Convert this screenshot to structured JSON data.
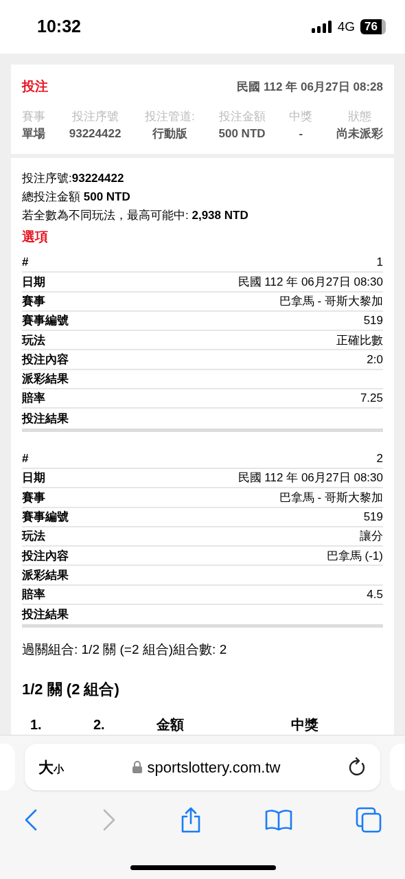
{
  "status_bar": {
    "time": "10:32",
    "network": "4G",
    "battery": "76"
  },
  "summary": {
    "title": "投注",
    "datetime": "民國 112 年 06月27日 08:28",
    "columns": [
      {
        "heading": "賽事",
        "value": "單場"
      },
      {
        "heading": "投注序號",
        "value": "93224422"
      },
      {
        "heading": "投注管道:",
        "value": "行動版"
      },
      {
        "heading": "投注金額",
        "value": "500 NTD"
      },
      {
        "heading": "中獎",
        "value": "-"
      },
      {
        "heading": "狀態",
        "value": "尚未派彩"
      }
    ]
  },
  "details": {
    "lines": [
      "投注序號:**93224422**",
      "總投注金額 **500 NTD**",
      "若全數為不同玩法，最高可能中: **2,938 NTD**"
    ],
    "options_title": "選項",
    "selections": [
      {
        "rows": [
          {
            "label": "#",
            "value": "1"
          },
          {
            "label": "日期",
            "value": "民國 112 年 06月27日 08:30"
          },
          {
            "label": "賽事",
            "value": "巴拿馬 - 哥斯大黎加"
          },
          {
            "label": "賽事編號",
            "value": "519"
          },
          {
            "label": "玩法",
            "value": "正確比數"
          },
          {
            "label": "投注內容",
            "value": "2:0"
          },
          {
            "label": "派彩結果"
          },
          {
            "label": "賠率",
            "value": "7.25"
          },
          {
            "label": "投注結果"
          }
        ]
      },
      {
        "rows": [
          {
            "label": "#",
            "value": "2"
          },
          {
            "label": "日期",
            "value": "民國 112 年 06月27日 08:30"
          },
          {
            "label": "賽事",
            "value": "巴拿馬 - 哥斯大黎加"
          },
          {
            "label": "賽事編號",
            "value": "519"
          },
          {
            "label": "玩法",
            "value": "讓分"
          },
          {
            "label": "投注內容",
            "value": "巴拿馬 (-1)"
          },
          {
            "label": "派彩結果"
          },
          {
            "label": "賠率",
            "value": "4.5"
          },
          {
            "label": "投注結果"
          }
        ]
      }
    ],
    "combo_line": "過關組合: 1/2 關 (=2 組合)組合數: 2",
    "combo_title": "1/2 關 (2 組合)",
    "combo_columns": [
      "1.",
      "2.",
      "金額",
      "中獎"
    ]
  },
  "browser": {
    "text_size": "大",
    "text_size_small": "小",
    "url": "sportslottery.com.tw",
    "toolbar": [
      {
        "kind": "back",
        "disabled": false
      },
      {
        "kind": "forward",
        "disabled": true
      },
      {
        "kind": "share",
        "disabled": false
      },
      {
        "kind": "bookmarks",
        "disabled": false
      },
      {
        "kind": "tabs",
        "disabled": false
      }
    ]
  }
}
